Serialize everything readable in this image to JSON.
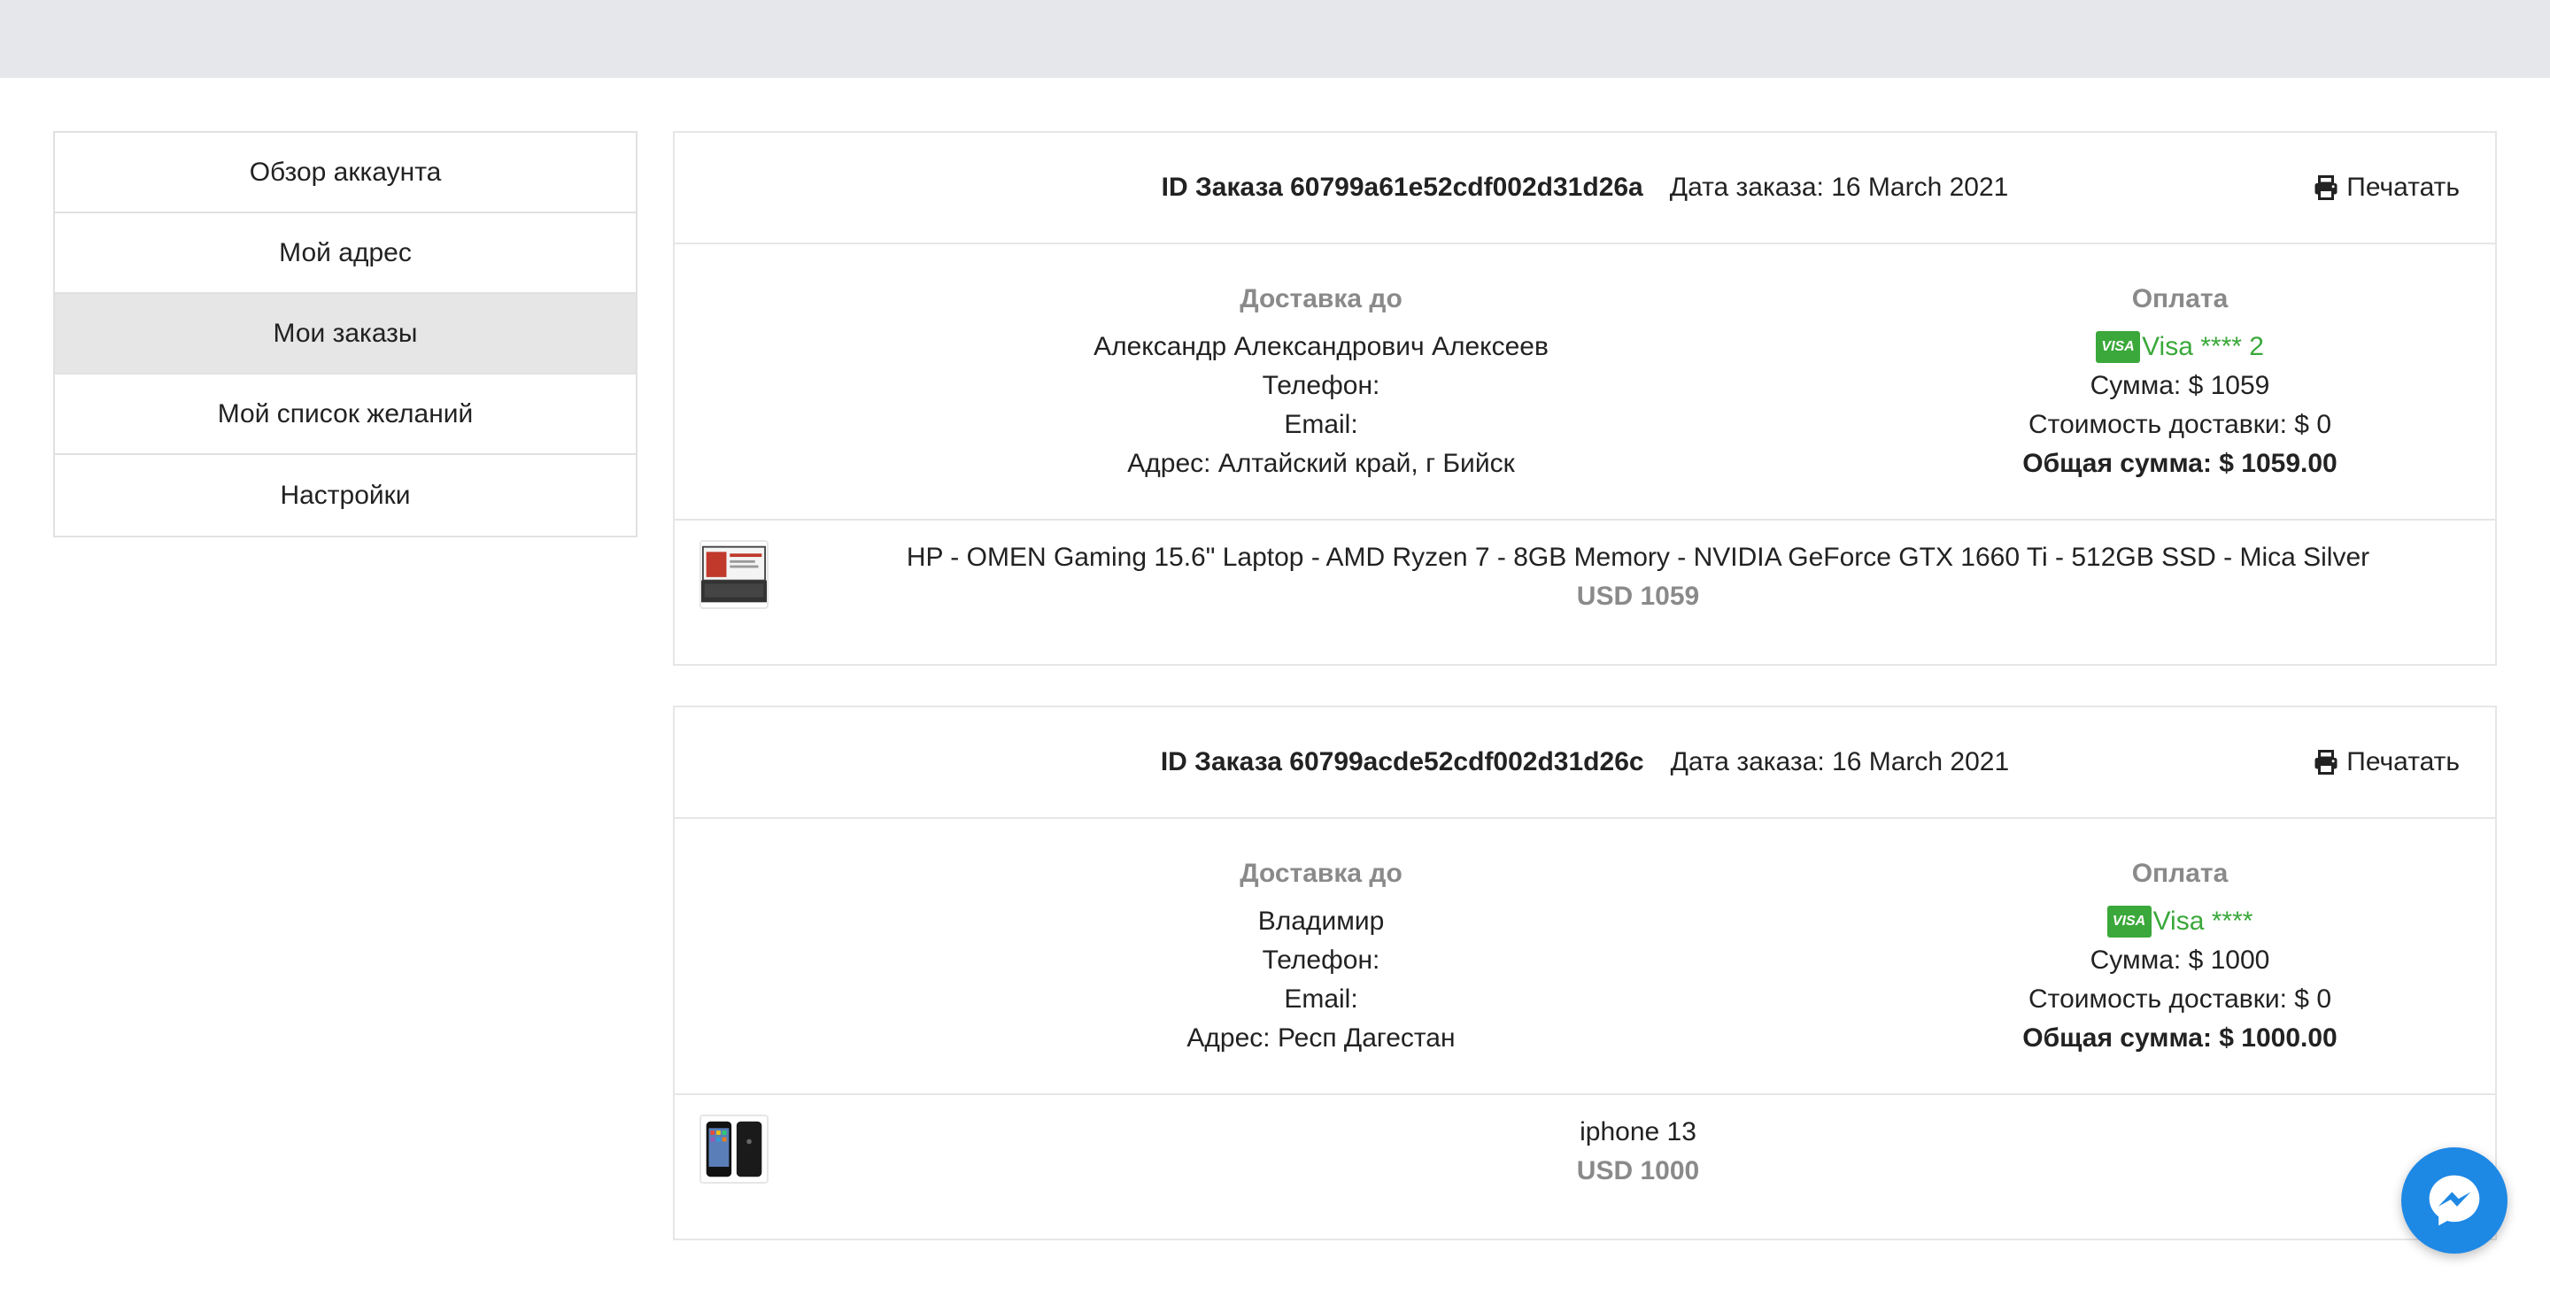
{
  "sidebar": {
    "items": [
      {
        "label": "Обзор аккаунта"
      },
      {
        "label": "Мой адрес"
      },
      {
        "label": "Мои заказы"
      },
      {
        "label": "Мой список желаний"
      },
      {
        "label": "Настройки"
      }
    ]
  },
  "orders": [
    {
      "id_label": "ID Заказа 60799a61e52cdf002d31d26a",
      "date_label": "Дата заказа: 16 March 2021",
      "print_label": "Печатать",
      "shipping": {
        "title": "Доставка до",
        "name": "Александр Александрович Алексеев",
        "phone": "Телефон:",
        "email": "Email:",
        "address": "Адрес: Алтайский край, г Бийск"
      },
      "payment": {
        "title": "Оплата",
        "card_badge": "VISA",
        "card": "Visa **** 2",
        "sum": "Сумма: $ 1059",
        "shipping_cost": "Стоимость доставки: $ 0",
        "total": "Общая сумма: $ 1059.00"
      },
      "item": {
        "name": "HP - OMEN Gaming 15.6\" Laptop - AMD Ryzen 7 - 8GB Memory - NVIDIA GeForce GTX 1660 Ti - 512GB SSD - Mica Silver",
        "price": "USD 1059"
      }
    },
    {
      "id_label": "ID Заказа 60799acde52cdf002d31d26c",
      "date_label": "Дата заказа: 16 March 2021",
      "print_label": "Печатать",
      "shipping": {
        "title": "Доставка до",
        "name": "Владимир",
        "phone": "Телефон:",
        "email": "Email:",
        "address": "Адрес: Респ Дагестан"
      },
      "payment": {
        "title": "Оплата",
        "card_badge": "VISA",
        "card": "Visa ****",
        "sum": "Сумма: $ 1000",
        "shipping_cost": "Стоимость доставки: $ 0",
        "total": "Общая сумма: $ 1000.00"
      },
      "item": {
        "name": "iphone 13",
        "price": "USD 1000"
      }
    }
  ],
  "colors": {
    "accent_green": "#3aa83a",
    "messenger_blue": "#1e88e5",
    "active_item_bg": "#e6e6e6"
  },
  "icons": {
    "print": "printer-icon",
    "messenger": "messenger-icon"
  }
}
